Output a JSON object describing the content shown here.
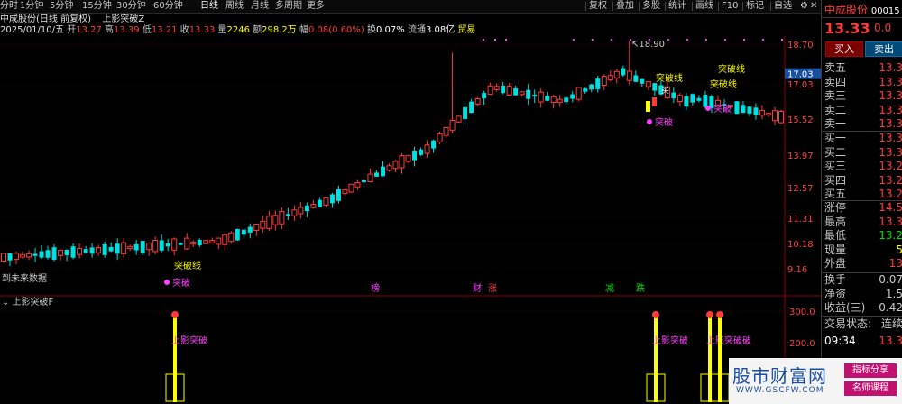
{
  "toolbar": {
    "left": [
      "分时",
      "1分钟",
      "5分钟",
      "15分钟",
      "30分钟",
      "60分钟",
      "日线",
      "周线",
      "月线",
      "多周期",
      "更多"
    ],
    "active": "日线",
    "right": [
      "复权",
      "叠加",
      "多股",
      "统计",
      "画线",
      "F10",
      "标记",
      "自选"
    ],
    "icons": [
      "gear-icon",
      "chevron-left-icon",
      "close-icon"
    ]
  },
  "title_row": {
    "name": "中成股份(日线 前复权)",
    "indicator": "上影突破Z"
  },
  "ohlc_row": {
    "date": "2025/01/10/五",
    "open_label": "开",
    "open": "13.27",
    "high_label": "高",
    "high": "13.39",
    "low_label": "低",
    "low": "13.21",
    "close_label": "收",
    "close": "13.33",
    "volume_label": "量",
    "volume": "2246",
    "amount_label": "额",
    "amount": "298.2万",
    "change_label": "幅",
    "change": "0.08(0.60%)",
    "turnover_label": "换",
    "turnover": "0.07%",
    "float_label": "流通",
    "float": "3.08亿",
    "sector": "贸易"
  },
  "main_chart": {
    "y_ticks": [
      "18.70",
      "17.03",
      "15.52",
      "13.97",
      "12.57",
      "11.31",
      "10.18",
      "9.16"
    ],
    "current_price_tag": "17.03",
    "peak_label": "18.90",
    "signal_label": "突破线",
    "buy_label": "买",
    "breakout_label": "突破",
    "left_note": "到未来数据",
    "event_markers": [
      {
        "text": "榜",
        "color": "#ff40ff"
      },
      {
        "text": "财",
        "color": "#ff40ff"
      },
      {
        "text": "涨",
        "color": "#ff4040"
      },
      {
        "text": "减",
        "color": "#00e000"
      },
      {
        "text": "跌",
        "color": "#00e000"
      }
    ]
  },
  "sub_chart": {
    "title": "上影突破F",
    "y_ticks": [
      "300.0",
      "200.0"
    ],
    "signal_label": "上影突破",
    "signal_label_2": "上影突破破"
  },
  "right_panel": {
    "stock_name": "中成股份",
    "stock_code": "00015",
    "price": "13.33",
    "change": "0.0",
    "buy_btn": "买入",
    "sell_btn": "卖出",
    "sell_rows": [
      {
        "label": "卖五",
        "price": "13.3"
      },
      {
        "label": "卖四",
        "price": "13.3"
      },
      {
        "label": "卖三",
        "price": "13.3"
      },
      {
        "label": "卖二",
        "price": "13.3"
      },
      {
        "label": "卖一",
        "price": "13.3"
      }
    ],
    "buy_rows": [
      {
        "label": "买一",
        "price": "13.3"
      },
      {
        "label": "买二",
        "price": "13.3"
      },
      {
        "label": "买三",
        "price": "13.2"
      },
      {
        "label": "买四",
        "price": "13.2"
      },
      {
        "label": "买五",
        "price": "13.2"
      }
    ],
    "stats": [
      {
        "label": "涨停",
        "value": "14.5",
        "color": "#ff3b3b"
      },
      {
        "label": "最高",
        "value": "13.3",
        "color": "#ff3b3b"
      },
      {
        "label": "最低",
        "value": "13.2",
        "color": "#00e000"
      },
      {
        "label": "现量",
        "value": "5",
        "color": "#ffff00"
      },
      {
        "label": "外盘",
        "value": "13",
        "color": "#ff3b3b"
      }
    ],
    "stats2": [
      {
        "label": "换手",
        "value": "0.07",
        "color": "#c8c8c8"
      },
      {
        "label": "净资",
        "value": "1.5",
        "color": "#c8c8c8"
      },
      {
        "label": "收益(三)",
        "value": "-0.42",
        "color": "#c8c8c8"
      }
    ],
    "trade_status_label": "交易状态:",
    "trade_status": "连续",
    "time": "09:34",
    "time_price": "13.3"
  },
  "watermark": {
    "brand": "股市财富网",
    "url": "WWW.GSCFW.COM",
    "tag1": "指标分享",
    "tag2": "名师课程"
  }
}
